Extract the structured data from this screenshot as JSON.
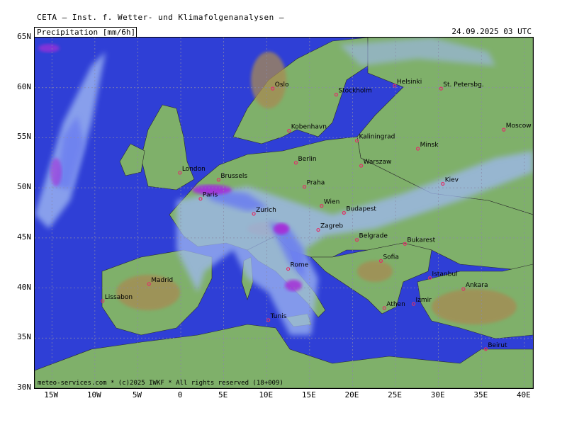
{
  "header": {
    "title": "CETA — Inst. f. Wetter- und Klimafolgenanalysen —"
  },
  "panel": {
    "variable_label": "Precipitation [mm/6h]",
    "valid_time": "24.09.2025 03 UTC"
  },
  "footer": {
    "credit": "meteo-services.com * (c)2025 IWKF * All rights reserved (18+009)"
  },
  "axes": {
    "lat_labels": [
      "65N",
      "60N",
      "55N",
      "50N",
      "45N",
      "40N",
      "35N",
      "30N"
    ],
    "lon_labels": [
      "15W",
      "10W",
      "5W",
      "0",
      "5E",
      "10E",
      "15E",
      "20E",
      "25E",
      "30E",
      "35E",
      "40E"
    ]
  },
  "cities": [
    {
      "name": "Oslo",
      "lon": 10.7,
      "lat": 59.9
    },
    {
      "name": "Stockholm",
      "lon": 18.1,
      "lat": 59.3
    },
    {
      "name": "Helsinki",
      "lon": 24.9,
      "lat": 60.2
    },
    {
      "name": "St. Petersbg.",
      "lon": 30.3,
      "lat": 59.9
    },
    {
      "name": "Kobenhavn",
      "lon": 12.6,
      "lat": 55.7
    },
    {
      "name": "Kaliningrad",
      "lon": 20.5,
      "lat": 54.7
    },
    {
      "name": "Minsk",
      "lon": 27.6,
      "lat": 53.9
    },
    {
      "name": "Moscow",
      "lon": 37.6,
      "lat": 55.8
    },
    {
      "name": "London",
      "lon": -0.1,
      "lat": 51.5
    },
    {
      "name": "Berlin",
      "lon": 13.4,
      "lat": 52.5
    },
    {
      "name": "Warszaw",
      "lon": 21.0,
      "lat": 52.2
    },
    {
      "name": "Brussels",
      "lon": 4.4,
      "lat": 50.8
    },
    {
      "name": "Praha",
      "lon": 14.4,
      "lat": 50.1
    },
    {
      "name": "Kiev",
      "lon": 30.5,
      "lat": 50.4
    },
    {
      "name": "Paris",
      "lon": 2.3,
      "lat": 48.9
    },
    {
      "name": "Wien",
      "lon": 16.4,
      "lat": 48.2
    },
    {
      "name": "Budapest",
      "lon": 19.0,
      "lat": 47.5
    },
    {
      "name": "Zurich",
      "lon": 8.5,
      "lat": 47.4
    },
    {
      "name": "Zagreb",
      "lon": 16.0,
      "lat": 45.8
    },
    {
      "name": "Belgrade",
      "lon": 20.5,
      "lat": 44.8
    },
    {
      "name": "Bukarest",
      "lon": 26.1,
      "lat": 44.4
    },
    {
      "name": "Sofia",
      "lon": 23.3,
      "lat": 42.7
    },
    {
      "name": "Istanbul",
      "lon": 29.0,
      "lat": 41.0
    },
    {
      "name": "Ankara",
      "lon": 32.9,
      "lat": 39.9
    },
    {
      "name": "Rome",
      "lon": 12.5,
      "lat": 41.9
    },
    {
      "name": "Madrid",
      "lon": -3.7,
      "lat": 40.4
    },
    {
      "name": "Lissabon",
      "lon": -9.1,
      "lat": 38.7
    },
    {
      "name": "Athen",
      "lon": 23.7,
      "lat": 38.0
    },
    {
      "name": "Izmir",
      "lon": 27.1,
      "lat": 38.4
    },
    {
      "name": "Tunis",
      "lon": 10.2,
      "lat": 36.8
    },
    {
      "name": "Beirut",
      "lon": 35.5,
      "lat": 33.9
    }
  ],
  "colors": {
    "sea": "#2f3fd6",
    "land_low": "#7fb06a",
    "land_high": "#a88a52",
    "precip_light": "#9fb8f2",
    "precip_mod": "#6a7df0",
    "precip_heavy": "#a52ed8",
    "city_marker": "#e0306a"
  }
}
